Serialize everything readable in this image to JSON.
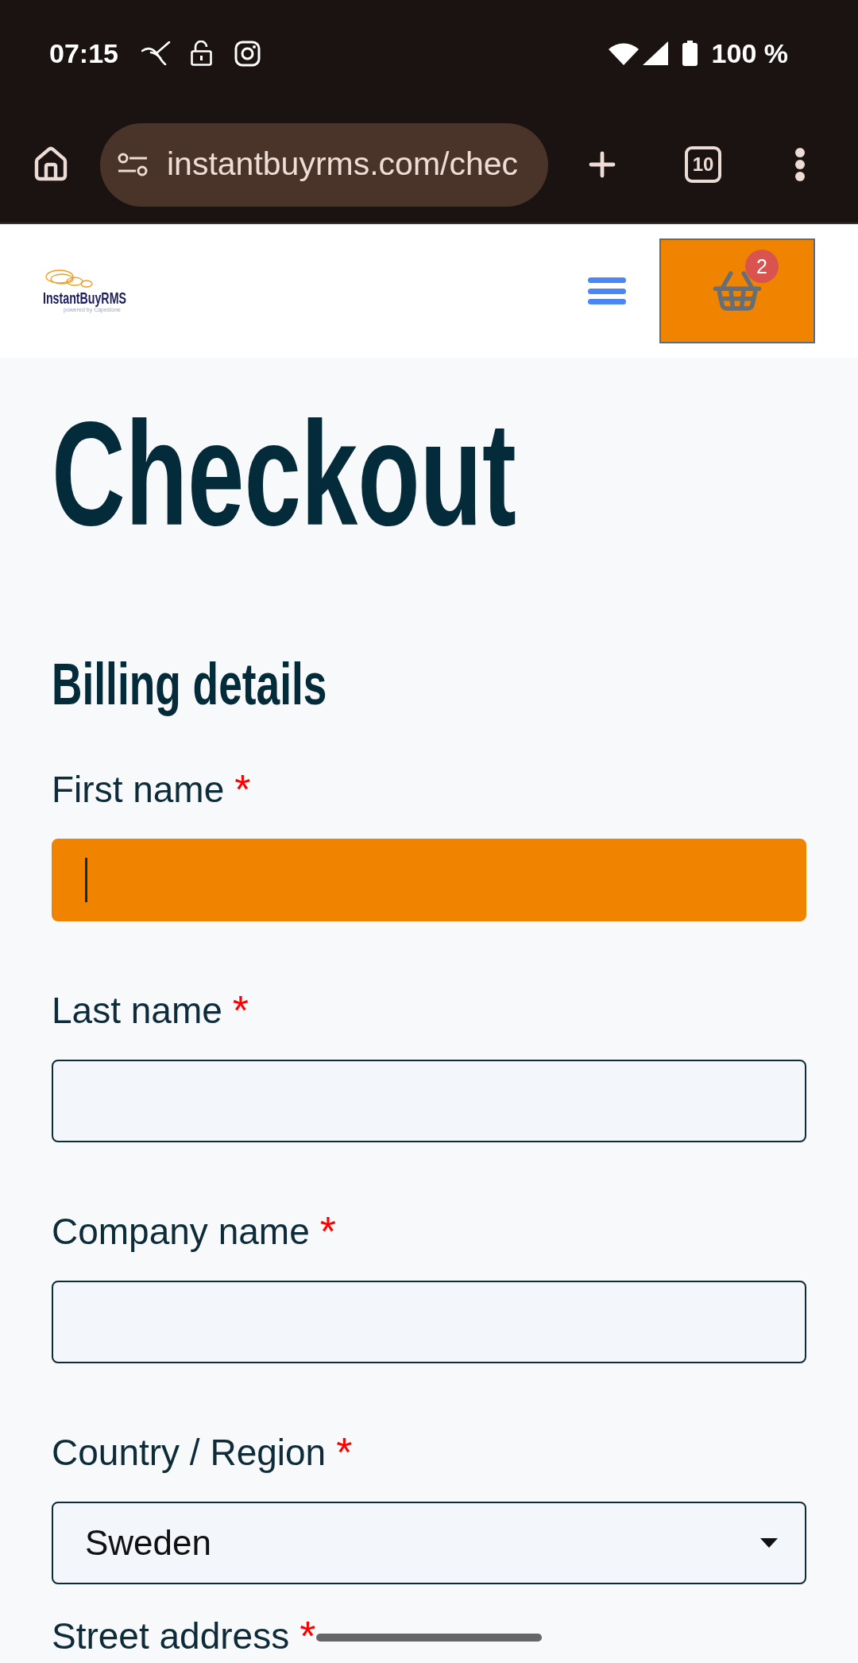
{
  "status_bar": {
    "time": "07:15",
    "battery_percent": "100 %"
  },
  "browser_toolbar": {
    "url": "instantbuyrms.com/chec",
    "tab_count": "10"
  },
  "site_header": {
    "logo": {
      "name": "InstantBuyRMS",
      "tagline": "powered by Capestone"
    },
    "cart": {
      "count": "2"
    }
  },
  "page": {
    "title": "Checkout",
    "section_title": "Billing details"
  },
  "fields": [
    {
      "label": "First name",
      "required_mark": "*",
      "input": {
        "kind": "text",
        "focused": true
      }
    },
    {
      "label": "Last name",
      "required_mark": "*",
      "input": {
        "kind": "text",
        "focused": false
      }
    },
    {
      "label": "Company name",
      "required_mark": "*",
      "input": {
        "kind": "text",
        "focused": false
      }
    },
    {
      "label": "Country / Region",
      "required_mark": "*",
      "input": {
        "kind": "select",
        "value": "Sweden"
      }
    },
    {
      "label": "Street address",
      "required_mark": "*"
    }
  ]
}
